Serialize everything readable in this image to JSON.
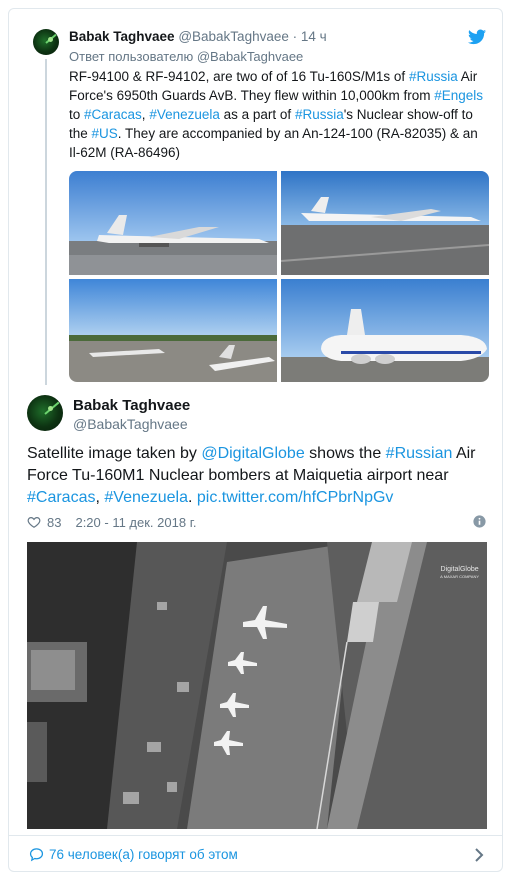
{
  "quoted_tweet": {
    "author_name": "Babak Taghvaee",
    "handle": "@BabakTaghvaee",
    "separator": "·",
    "time": "14 ч",
    "reply_prefix": "Ответ пользователю ",
    "reply_handle": "@BabakTaghvaee",
    "text_parts": [
      {
        "t": "RF-94100 & RF-94102, are two of of 16 Tu-160S/M1s of "
      },
      {
        "t": "#Russia",
        "tag": true
      },
      {
        "t": " Air Force's 6950th Guards AvB. They flew within 10,000km from "
      },
      {
        "t": "#Engels",
        "tag": true
      },
      {
        "t": " to "
      },
      {
        "t": "#Caracas",
        "tag": true
      },
      {
        "t": ", "
      },
      {
        "t": "#Venezuela",
        "tag": true
      },
      {
        "t": " as a part of "
      },
      {
        "t": "#Russia",
        "tag": true
      },
      {
        "t": "'s Nuclear show-off to the "
      },
      {
        "t": "#US",
        "tag": true
      },
      {
        "t": ". They are accompanied by an An-124-100 (RA-82035) & an Il-62M (RA-86496)"
      }
    ]
  },
  "main_tweet": {
    "author_name": "Babak Taghvaee",
    "handle": "@BabakTaghvaee",
    "text_parts": [
      {
        "t": "Satellite image taken by "
      },
      {
        "t": "@DigitalGlobe",
        "tag": true
      },
      {
        "t": " shows the "
      },
      {
        "t": "#Russian",
        "tag": true
      },
      {
        "t": " Air Force Tu-160M1 Nuclear bombers at Maiquetia airport near "
      },
      {
        "t": "#Caracas",
        "tag": true
      },
      {
        "t": ", "
      },
      {
        "t": "#Venezuela",
        "tag": true
      },
      {
        "t": ". "
      },
      {
        "t": "pic.twitter.com/hfCPbrNpGv",
        "tag": true
      }
    ],
    "likes": "83",
    "timestamp": "2:20 - 11 дек. 2018 г.",
    "satellite_watermark": "DigitalGlobe",
    "satellite_watermark_sub": "A MAXAR COMPANY"
  },
  "footer": {
    "talking": "76 человек(а) говорят об этом"
  },
  "colors": {
    "link": "#1b95e0",
    "muted": "#657786",
    "border": "#e1e8ed"
  },
  "icons": [
    "twitter-bird-icon",
    "heart-icon",
    "info-icon",
    "speech-bubble-icon",
    "chevron-right-icon"
  ]
}
